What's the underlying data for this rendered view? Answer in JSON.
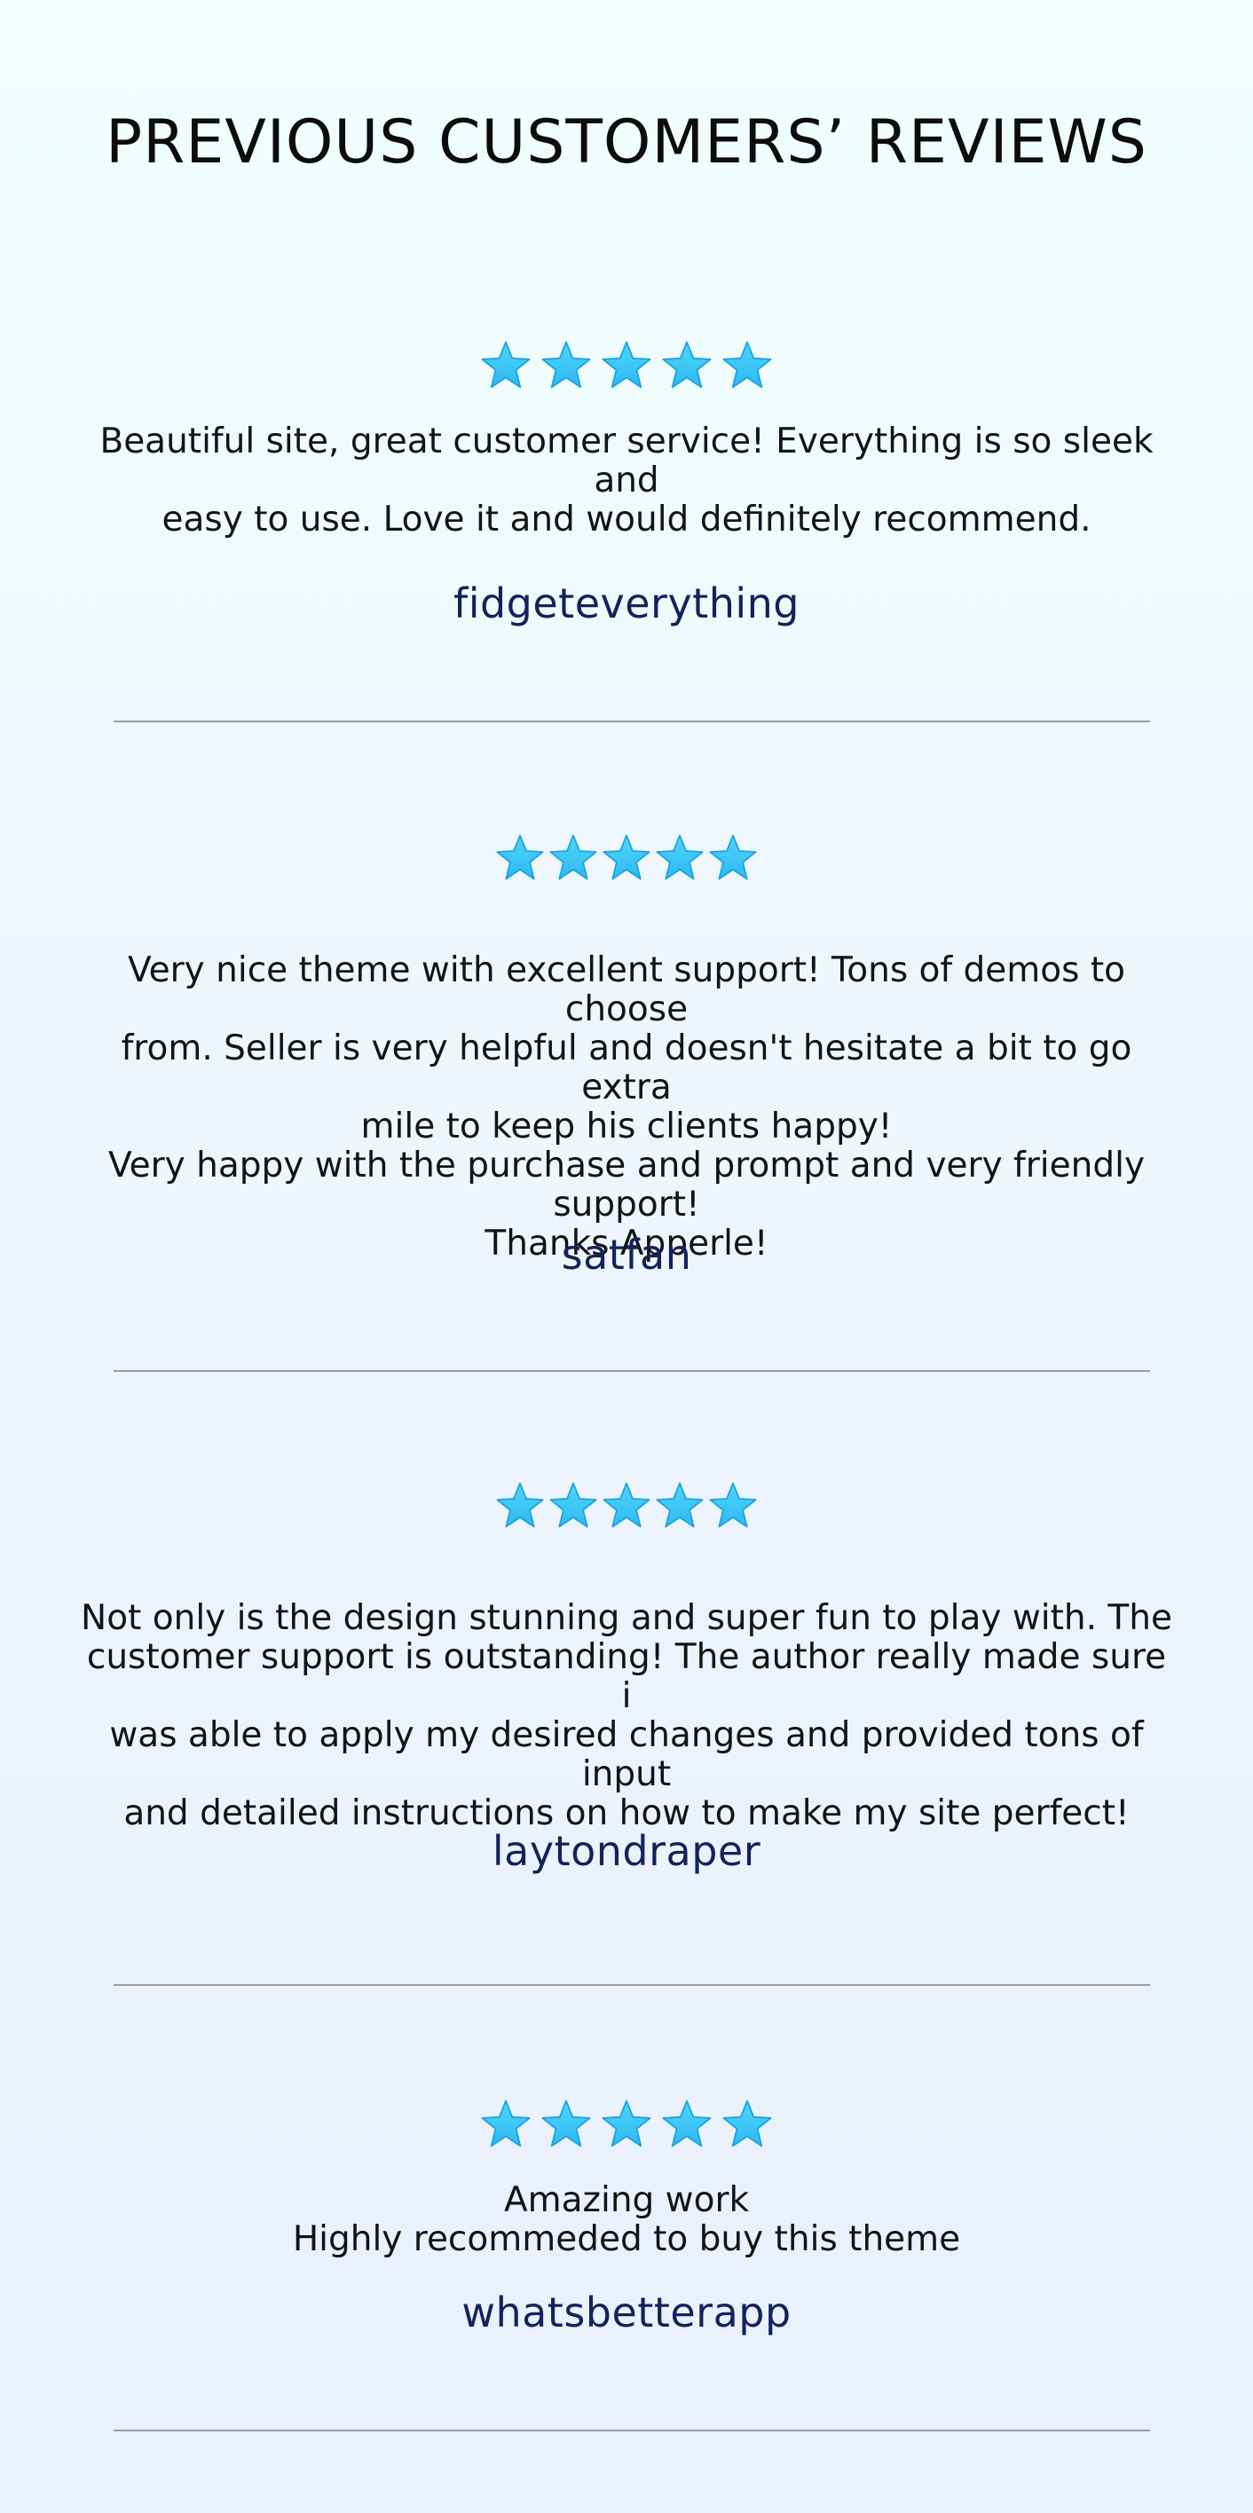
{
  "title": "PREVIOUS CUSTOMERS’ REVIEWS",
  "star_color": "#2fb9f0",
  "star_color_light": "#4fd6fb",
  "reviews": [
    {
      "rating": 5,
      "lines": [
        "Beautiful site, great customer service! Everything is so sleek and",
        "easy to use. Love it and would definitely recommend."
      ],
      "author": "fidgeteverything"
    },
    {
      "rating": 5,
      "lines": [
        "Very nice theme with excellent support! Tons of demos to choose",
        "from. Seller is very helpful and doesn't hesitate a bit to go extra",
        "mile to keep his clients happy!",
        "Very happy with the purchase and prompt and very friendly",
        "support!",
        "Thanks Apperle!"
      ],
      "author": "satfan"
    },
    {
      "rating": 5,
      "lines": [
        "Not only is the design stunning and super fun to play with. The",
        "customer support is outstanding! The author really made sure i",
        "was able to apply my desired changes and provided tons of input",
        "and detailed instructions on how to make my site perfect!"
      ],
      "author": "laytondraper"
    },
    {
      "rating": 5,
      "lines": [
        "Amazing work",
        "Highly recommeded to buy this theme"
      ],
      "author": "whatsbetterapp"
    }
  ]
}
